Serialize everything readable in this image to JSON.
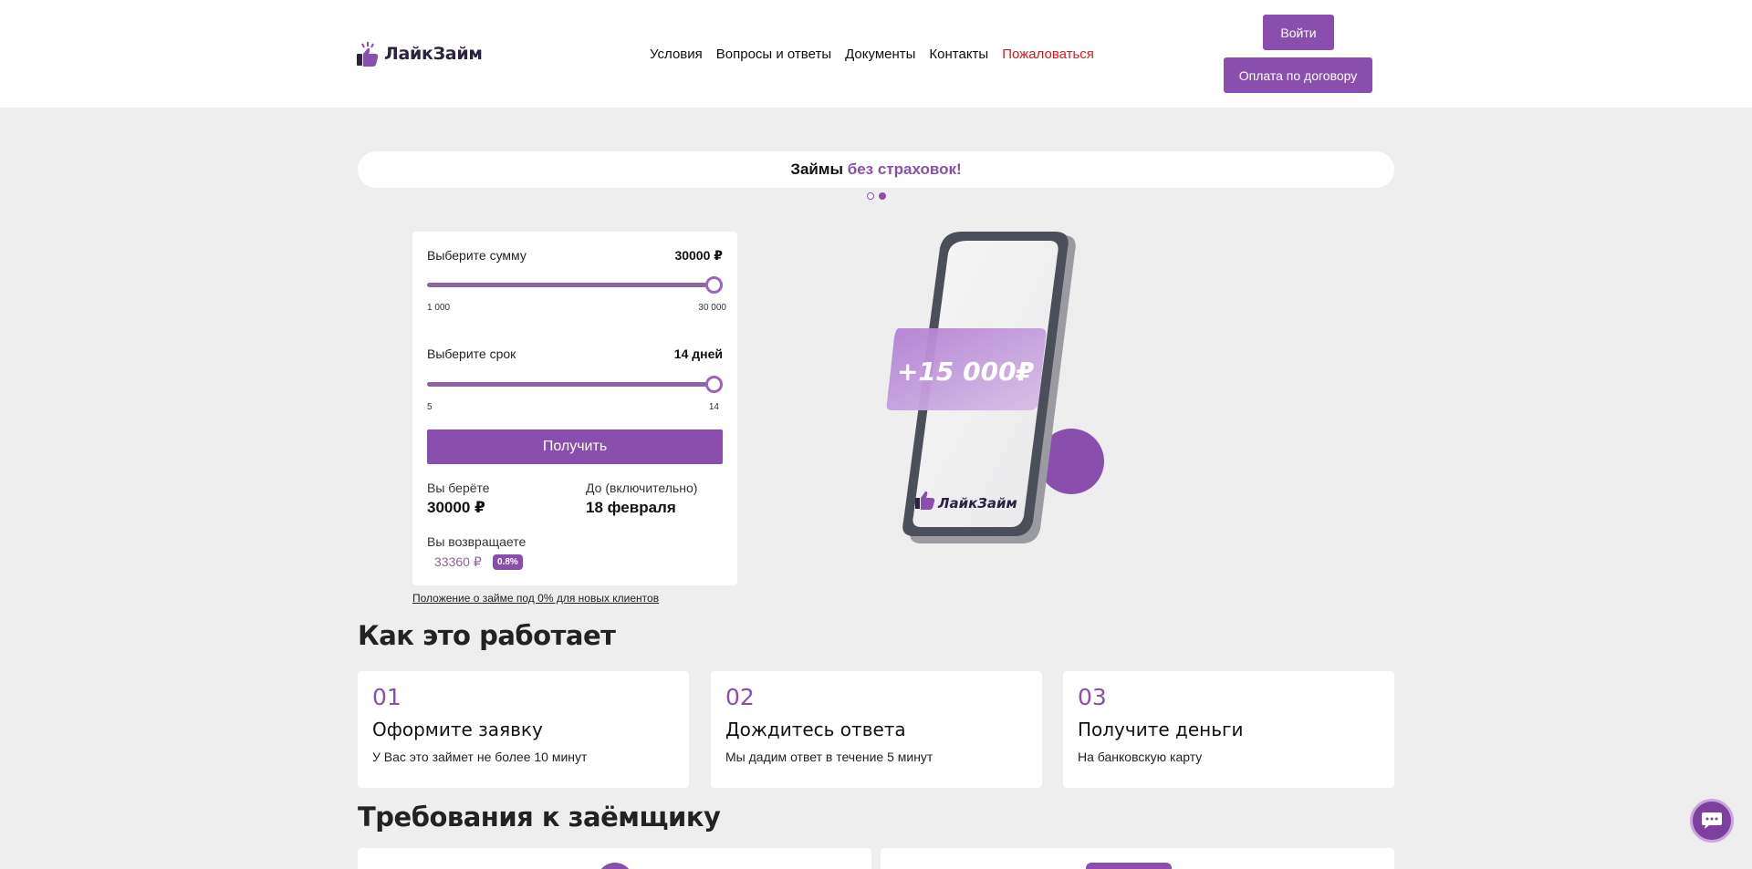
{
  "header": {
    "logo_text": "ЛайкЗайм",
    "nav": [
      "Условия",
      "Вопросы и ответы",
      "Документы",
      "Контакты"
    ],
    "nav_complain": "Пожаловаться",
    "login_label": "Войти",
    "pay_label": "Оплата по договору"
  },
  "banner": {
    "text_main": "Займы",
    "text_accent": "без страховок!"
  },
  "calculator": {
    "amount_label": "Выберите сумму",
    "amount_value": "30000 ₽",
    "amount_min": "1 000",
    "amount_max": "30 000",
    "amount_level": 1.0,
    "term_label": "Выберите срок",
    "term_value": "14 дней",
    "term_min": "5",
    "term_max": "14",
    "term_level": 1.0,
    "get_label": "Получить",
    "take_label": "Вы берёте",
    "take_value": "30000 ₽",
    "until_label": "До (включительно)",
    "until_value": "18 февраля",
    "return_label": "Вы возвращаете",
    "return_value": "33360 ₽",
    "rate_badge": "0.8%"
  },
  "terms_link": "Положение о займе под 0% для новых клиентов",
  "promo": {
    "card_amount": "+15 000₽",
    "phone_logo": "ЛайкЗайм"
  },
  "how_it_works": {
    "title": "Как это работает",
    "steps": [
      {
        "num": "01",
        "title": "Оформите заявку",
        "desc": "У Вас это займет не более 10 минут"
      },
      {
        "num": "02",
        "title": "Дождитесь ответа",
        "desc": "Мы дадим ответ в течение 5 минут"
      },
      {
        "num": "03",
        "title": "Получите деньги",
        "desc": "На банковскую карту"
      }
    ]
  },
  "requirements": {
    "title": "Требования к заёмщику"
  },
  "colors": {
    "accent": "#8a4fae",
    "complain": "#d61b1b",
    "background": "#eeeeee"
  },
  "icons": {
    "logo": "thumbs-up-icon",
    "chat": "chat-bubble-icon"
  }
}
